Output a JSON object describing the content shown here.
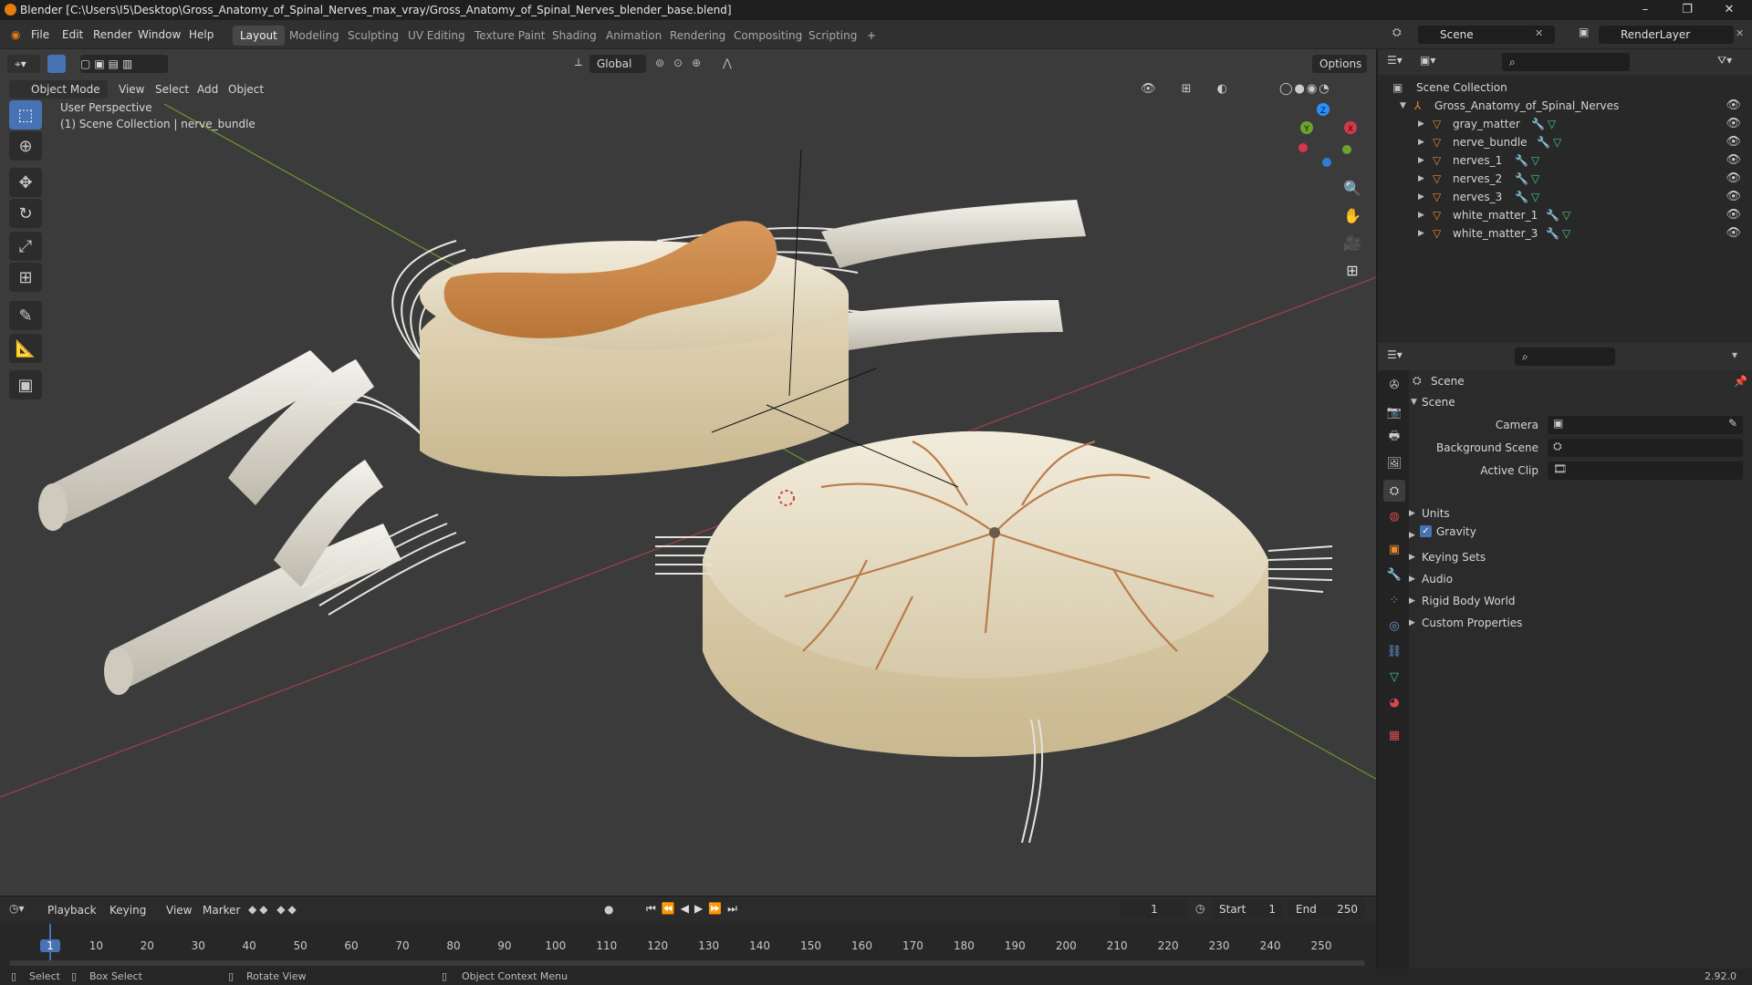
{
  "window": {
    "title": "Blender [C:\\Users\\I5\\Desktop\\Gross_Anatomy_of_Spinal_Nerves_max_vray/Gross_Anatomy_of_Spinal_Nerves_blender_base.blend]",
    "version": "2.92.0"
  },
  "menu": [
    "File",
    "Edit",
    "Render",
    "Window",
    "Help"
  ],
  "workspaces": [
    "Layout",
    "Modeling",
    "Sculpting",
    "UV Editing",
    "Texture Paint",
    "Shading",
    "Animation",
    "Rendering",
    "Compositing",
    "Scripting"
  ],
  "active_workspace": "Layout",
  "scene_field": "Scene",
  "renderlayer_field": "RenderLayer",
  "viewport": {
    "mode": "Object Mode",
    "menus": [
      "View",
      "Select",
      "Add",
      "Object"
    ],
    "orientation": "Global",
    "options": "Options",
    "overlay_line1": "User Perspective",
    "overlay_line2": "(1) Scene Collection | nerve_bundle",
    "gizmo_axes": [
      "X",
      "Y",
      "Z"
    ]
  },
  "outliner": {
    "root": "Scene Collection",
    "collection": "Gross_Anatomy_of_Spinal_Nerves",
    "objects": [
      "gray_matter",
      "nerve_bundle",
      "nerves_1",
      "nerves_2",
      "nerves_3",
      "white_matter_1",
      "white_matter_3"
    ]
  },
  "properties": {
    "context": "Scene",
    "panel": "Scene",
    "camera_label": "Camera",
    "bg_label": "Background Scene",
    "clip_label": "Active Clip",
    "sections": [
      "Units",
      "Gravity",
      "Keying Sets",
      "Audio",
      "Rigid Body World",
      "Custom Properties"
    ],
    "gravity_checked": true
  },
  "timeline": {
    "menus": [
      "Playback",
      "Keying",
      "View",
      "Marker"
    ],
    "current_frame": "1",
    "start_label": "Start",
    "start": "1",
    "end_label": "End",
    "end": "250",
    "ticks": [
      "1",
      "10",
      "20",
      "30",
      "40",
      "50",
      "60",
      "70",
      "80",
      "90",
      "100",
      "110",
      "120",
      "130",
      "140",
      "150",
      "160",
      "170",
      "180",
      "190",
      "200",
      "210",
      "220",
      "230",
      "240",
      "250"
    ]
  },
  "status": {
    "select": "Select",
    "box_select": "Box Select",
    "rotate": "Rotate View",
    "context_menu": "Object Context Menu"
  },
  "colors": {
    "accent": "#4772b3",
    "bone_light": "#efe8d6",
    "gray_matter": "#c98a4e",
    "nerve": "#e4e0d4"
  }
}
